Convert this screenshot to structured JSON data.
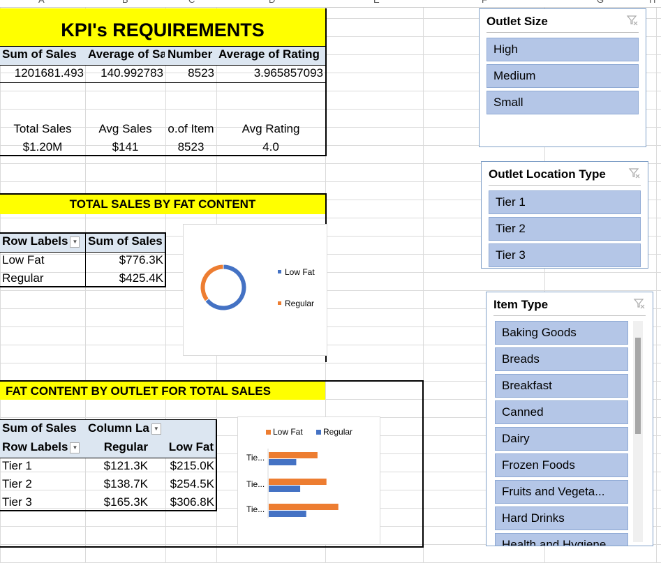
{
  "colors": {
    "accent_yellow": "#ffff00",
    "pivot_header": "#dce6f1",
    "slicer_item": "#b4c6e7",
    "low_fat": "#4472c4",
    "regular": "#ed7d31"
  },
  "column_headers": [
    "A",
    "B",
    "C",
    "D",
    "E",
    "F",
    "G",
    "H"
  ],
  "kpi": {
    "title": "KPI's REQUIREMENTS",
    "headers": [
      "Sum of Sales",
      "Average of Sa",
      "Number",
      "Average of Rating"
    ],
    "values": [
      "1201681.493",
      "140.992783",
      "8523",
      "3.965857093"
    ],
    "card_labels": [
      "Total Sales",
      "Avg Sales",
      "o.of Item",
      "Avg Rating"
    ],
    "card_values": [
      "$1.20M",
      "$141",
      "8523",
      "4.0"
    ]
  },
  "fat_content": {
    "title": "TOTAL SALES BY FAT CONTENT",
    "row_labels_header": "Row Labels",
    "sum_header": "Sum of Sales",
    "rows": [
      {
        "label": "Low Fat",
        "value": "$776.3K"
      },
      {
        "label": "Regular",
        "value": "$425.4K"
      }
    ]
  },
  "outlet_fat": {
    "title": "FAT CONTENT BY OUTLET FOR TOTAL SALES",
    "sum_header": "Sum of Sales",
    "column_labels": "Column La",
    "row_labels_header": "Row Labels",
    "col_regular": "Regular",
    "col_lowfat": "Low Fat",
    "rows": [
      {
        "label": "Tier 1",
        "regular": "$121.3K",
        "lowfat": "$215.0K"
      },
      {
        "label": "Tier 2",
        "regular": "$138.7K",
        "lowfat": "$254.5K"
      },
      {
        "label": "Tier 3",
        "regular": "$165.3K",
        "lowfat": "$306.8K"
      }
    ]
  },
  "chart_data": [
    {
      "type": "pie",
      "categories": [
        "Low Fat",
        "Regular"
      ],
      "values": [
        776.3,
        425.4
      ],
      "legend": "right"
    },
    {
      "type": "bar",
      "categories": [
        "Tie...",
        "Tie...",
        "Tie..."
      ],
      "series": [
        {
          "name": "Low Fat",
          "values": [
            215.0,
            254.5,
            306.8
          ]
        },
        {
          "name": "Regular",
          "values": [
            121.3,
            138.7,
            165.3
          ]
        }
      ],
      "legend": "top"
    }
  ],
  "slicers": {
    "outlet_size": {
      "title": "Outlet Size",
      "items": [
        "High",
        "Medium",
        "Small"
      ]
    },
    "outlet_location": {
      "title": "Outlet Location Type",
      "items": [
        "Tier 1",
        "Tier 2",
        "Tier 3"
      ]
    },
    "item_type": {
      "title": "Item Type",
      "items": [
        "Baking Goods",
        "Breads",
        "Breakfast",
        "Canned",
        "Dairy",
        "Frozen Foods",
        "Fruits and Vegeta...",
        "Hard Drinks",
        "Health and Hygiene"
      ]
    }
  },
  "icons": {
    "clear_filter": "clear-filter-icon",
    "dropdown": "dropdown-arrow-icon"
  }
}
